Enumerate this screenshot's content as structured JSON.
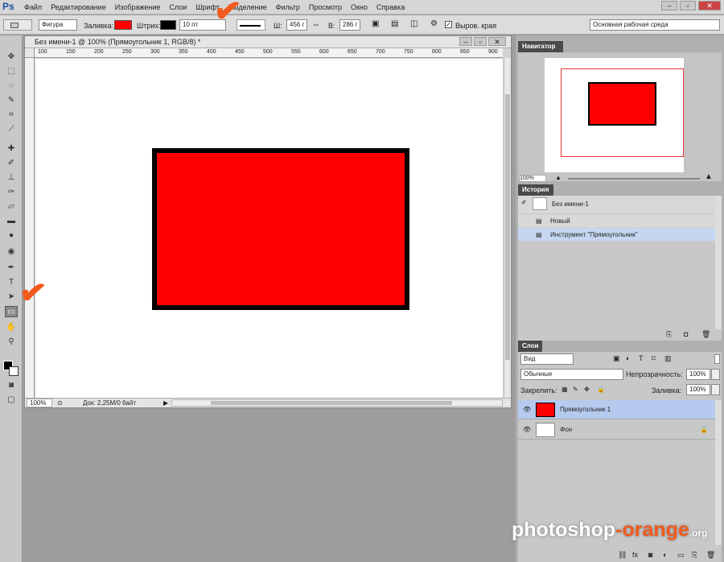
{
  "menubar": {
    "logo": "Ps",
    "items": [
      "Файл",
      "Редактирование",
      "Изображение",
      "Слои",
      "Шрифт",
      "Выделение",
      "Фильтр",
      "Просмотр",
      "Окно",
      "Справка"
    ],
    "minimize": "–",
    "restore": "▫",
    "close": "✕"
  },
  "options": {
    "shape_mode": "Фигура",
    "fill_label": "Заливка:",
    "fill_color": "#ff0000",
    "stroke_label": "Штрих:",
    "stroke_color": "#000000",
    "stroke_width": "10 пт",
    "w_label": "Ш:",
    "w_value": "456 г",
    "b_label": "В:",
    "h_value": "286 г",
    "align_edges": "Выров. края",
    "workspace": "Основная рабочая среда"
  },
  "document": {
    "title": "Без имени-1 @ 100% (Прямоугольник 1, RGB/8) *",
    "zoom": "100%",
    "doc_info": "Док: 2,25M/0 байт",
    "ruler_ticks": [
      "100",
      "150",
      "200",
      "250",
      "300",
      "350",
      "400",
      "450",
      "500",
      "550",
      "600",
      "650",
      "700",
      "750",
      "800",
      "850",
      "900"
    ],
    "fill_color": "#ff0000",
    "stroke_color": "#000000"
  },
  "navigator": {
    "title": "Навигатор",
    "zoom": "100%"
  },
  "history": {
    "title": "История",
    "snapshot": "Без имени-1",
    "items": [
      "Новый",
      "Инструмент \"Прямоугольник\""
    ]
  },
  "layers": {
    "title": "Слои",
    "filter": "Вид",
    "blend": "Обычные",
    "opacity_label": "Непрозрачность:",
    "opacity": "100%",
    "lock_label": "Закрепить:",
    "fill_label": "Заливка:",
    "fill": "100%",
    "items": [
      "Прямоугольник 1",
      "Фон"
    ]
  },
  "watermark": {
    "a": "photoshop",
    "b": "-",
    "c": "orange",
    ".org": ".org"
  }
}
